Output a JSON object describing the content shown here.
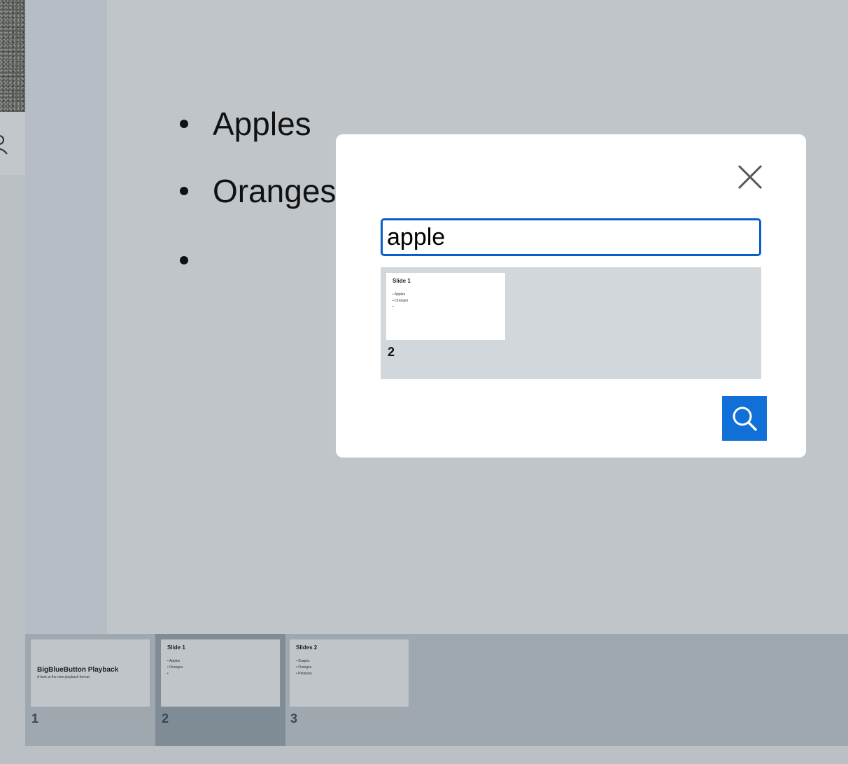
{
  "slide": {
    "bullets": [
      "Apples",
      "Oranges",
      ""
    ]
  },
  "search_modal": {
    "query": "apple",
    "results": [
      {
        "slide_number": "2",
        "preview_title": "Slide 1",
        "preview_lines": [
          "• Apples",
          "• Oranges",
          "•"
        ]
      }
    ],
    "close_icon": "close-icon",
    "search_icon": "search-icon",
    "accent_color": "#1070d8"
  },
  "filmstrip": {
    "thumbnails": [
      {
        "number": "1",
        "heading": "BigBlueButton Playback",
        "subheading": "A look at the new playback format"
      },
      {
        "number": "2",
        "title": "Slide 1",
        "lines": [
          "• Apples",
          "• Oranges",
          "•"
        ]
      },
      {
        "number": "3",
        "title": "Slides 2",
        "lines": [
          "• Grapes",
          "• Oranges",
          "• Potatoes"
        ]
      }
    ],
    "active_index": 1
  },
  "sidebar": {
    "user_icon": "user-icon"
  }
}
